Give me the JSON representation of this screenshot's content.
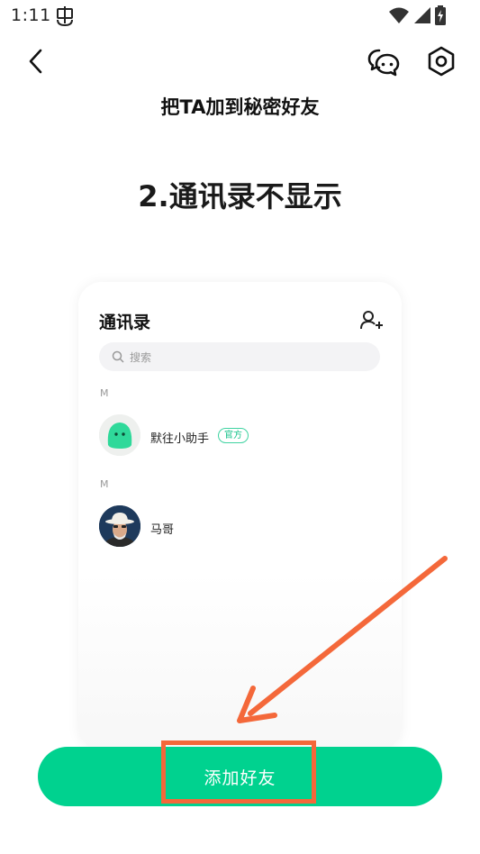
{
  "status_bar": {
    "time": "1:11",
    "app_icon": "bug-icon",
    "wifi_icon": "wifi-icon",
    "signal_icon": "signal-icon",
    "battery_icon": "battery-charging-icon"
  },
  "nav": {
    "back_icon": "chevron-left-icon",
    "chat_icon": "chat-bubbles-icon",
    "settings_icon": "hexagon-settings-icon"
  },
  "page_title": "把TA加到秘密好友",
  "step_title": "2.通讯录不显示",
  "preview": {
    "header": "通讯录",
    "add_contact_icon": "add-contact-icon",
    "search_placeholder": "搜索",
    "sections": [
      {
        "letter": "M",
        "contacts": [
          {
            "name": "默往小助手",
            "badge": "官方",
            "avatar": "green-bot-avatar"
          }
        ]
      },
      {
        "letter": "M",
        "contacts": [
          {
            "name": "马哥",
            "badge": "",
            "avatar": "man-with-hat-avatar"
          }
        ]
      }
    ]
  },
  "add_friend_button": {
    "label": "添加好友"
  },
  "colors": {
    "accent": "#00d28f",
    "highlight": "#f4683a",
    "badge": "#16c28a"
  }
}
